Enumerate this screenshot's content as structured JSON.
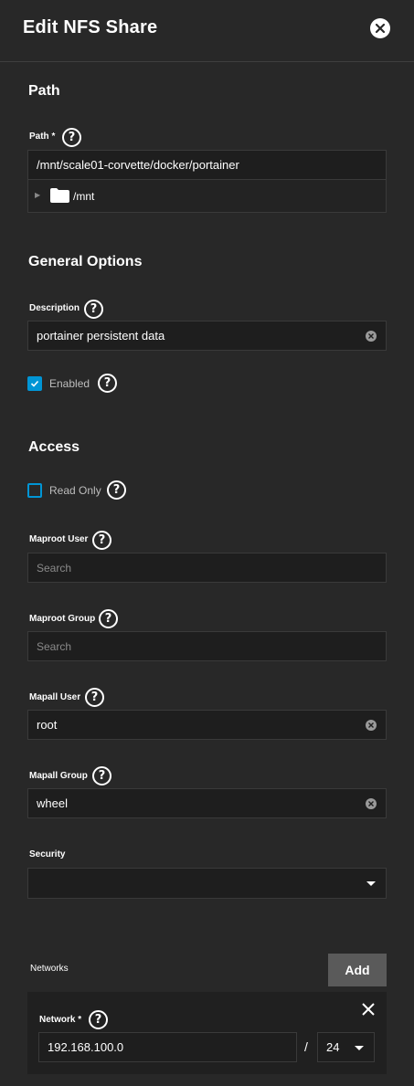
{
  "dialog": {
    "title": "Edit NFS Share"
  },
  "path_section": {
    "title": "Path",
    "path_label": "Path",
    "required_marker": "*",
    "path_value": "/mnt/scale01-corvette/docker/portainer",
    "tree_root": "/mnt"
  },
  "general": {
    "title": "General Options",
    "description_label": "Description",
    "description_value": "portainer persistent data",
    "enabled_label": "Enabled",
    "enabled": true
  },
  "access": {
    "title": "Access",
    "read_only_label": "Read Only",
    "read_only": false,
    "maproot_user_label": "Maproot User",
    "maproot_user_placeholder": "Search",
    "maproot_group_label": "Maproot Group",
    "maproot_group_placeholder": "Search",
    "mapall_user_label": "Mapall User",
    "mapall_user_value": "root",
    "mapall_group_label": "Mapall Group",
    "mapall_group_value": "wheel",
    "security_label": "Security",
    "security_value": ""
  },
  "networks": {
    "title": "Networks",
    "add_label": "Add",
    "items": [
      {
        "label": "Network",
        "required_marker": "*",
        "address": "192.168.100.0",
        "separator": "/",
        "mask": "24"
      }
    ]
  },
  "icons": {
    "help": "help-circle-icon",
    "close": "close-icon",
    "clear": "clear-icon",
    "folder": "folder-icon",
    "dropdown": "chevron-down-icon",
    "check": "check-icon"
  },
  "colors": {
    "background": "#282828",
    "input_background": "#1e1e1e",
    "accent": "#0095d5",
    "add_button": "#5a5a5a"
  }
}
